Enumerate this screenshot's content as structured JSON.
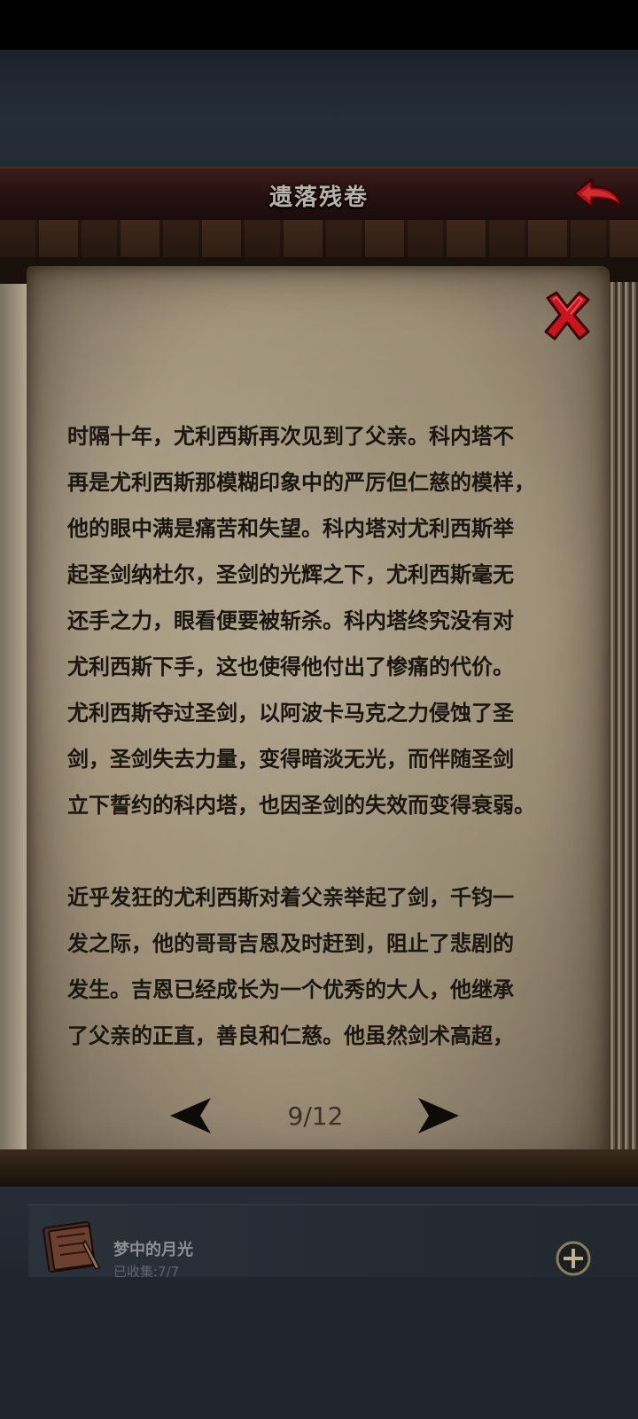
{
  "header": {
    "title": "遗落残卷"
  },
  "story": {
    "paragraph1_lines": [
      "时隔十年，尤利西斯再次见到了父亲。科内塔不",
      "再是尤利西斯那模糊印象中的严厉但仁慈的模样，",
      "他的眼中满是痛苦和失望。科内塔对尤利西斯举",
      "起圣剑纳杜尔，圣剑的光辉之下，尤利西斯毫无",
      "还手之力，眼看便要被斩杀。科内塔终究没有对",
      "尤利西斯下手，这也使得他付出了惨痛的代价。",
      "尤利西斯夺过圣剑，以阿波卡马克之力侵蚀了圣",
      "剑，圣剑失去力量，变得暗淡无光，而伴随圣剑",
      "立下誓约的科内塔，也因圣剑的失效而变得衰弱。"
    ],
    "paragraph2_lines": [
      "近乎发狂的尤利西斯对着父亲举起了剑，千钧一",
      "发之际，他的哥哥吉恩及时赶到，阻止了悲剧的",
      "发生。吉恩已经成长为一个优秀的大人，他继承",
      "了父亲的正直，善良和仁慈。他虽然剑术高超，"
    ]
  },
  "pager": {
    "page_text": "9/12"
  },
  "collection_item": {
    "title": "梦中的月光",
    "count": "已收集:7/7"
  },
  "colors": {
    "header_bg": "#241110",
    "parchment": "#a2947b",
    "close_red": "#c8141a",
    "text_dark": "#1c1610"
  },
  "icons": {
    "back": "back-arrow-icon",
    "close": "close-x-icon",
    "prev": "prev-page-arrow-icon",
    "next": "next-page-arrow-icon",
    "book": "book-icon",
    "plus": "plus-icon"
  }
}
